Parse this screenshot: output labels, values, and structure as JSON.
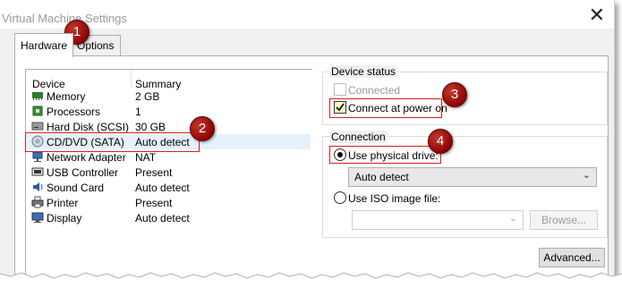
{
  "window": {
    "title": "Virtual Machine Settings",
    "close_glyph": "✕"
  },
  "tabs": [
    {
      "label": "Hardware",
      "active": true
    },
    {
      "label": "Options",
      "active": false
    }
  ],
  "device_list": {
    "headers": {
      "device": "Device",
      "summary": "Summary"
    },
    "rows": [
      {
        "name": "Memory",
        "summary": "2 GB",
        "icon": "memory-icon"
      },
      {
        "name": "Processors",
        "summary": "1",
        "icon": "processor-icon"
      },
      {
        "name": "Hard Disk (SCSI)",
        "summary": "30 GB",
        "icon": "hard-disk-icon"
      },
      {
        "name": "CD/DVD (SATA)",
        "summary": "Auto detect",
        "icon": "cd-dvd-icon",
        "selected": true
      },
      {
        "name": "Network Adapter",
        "summary": "NAT",
        "icon": "network-adapter-icon"
      },
      {
        "name": "USB Controller",
        "summary": "Present",
        "icon": "usb-icon"
      },
      {
        "name": "Sound Card",
        "summary": "Auto detect",
        "icon": "sound-card-icon"
      },
      {
        "name": "Printer",
        "summary": "Present",
        "icon": "printer-icon"
      },
      {
        "name": "Display",
        "summary": "Auto detect",
        "icon": "display-icon"
      }
    ]
  },
  "device_status": {
    "title": "Device status",
    "connected_label": "Connected",
    "connected_checked": false,
    "power_on_label": "Connect at power on",
    "power_on_checked": true
  },
  "connection": {
    "title": "Connection",
    "physical_label": "Use physical drive:",
    "physical_selected": true,
    "physical_value": "Auto detect",
    "iso_label": "Use ISO image file:",
    "iso_selected": false,
    "iso_value": "",
    "browse_label": "Browse..."
  },
  "advanced_label": "Advanced...",
  "callouts": [
    "1",
    "2",
    "3",
    "4"
  ],
  "colors": {
    "callout": "#a01010",
    "highlight_box": "#d42020",
    "selected_row": "#e5f1fb"
  }
}
